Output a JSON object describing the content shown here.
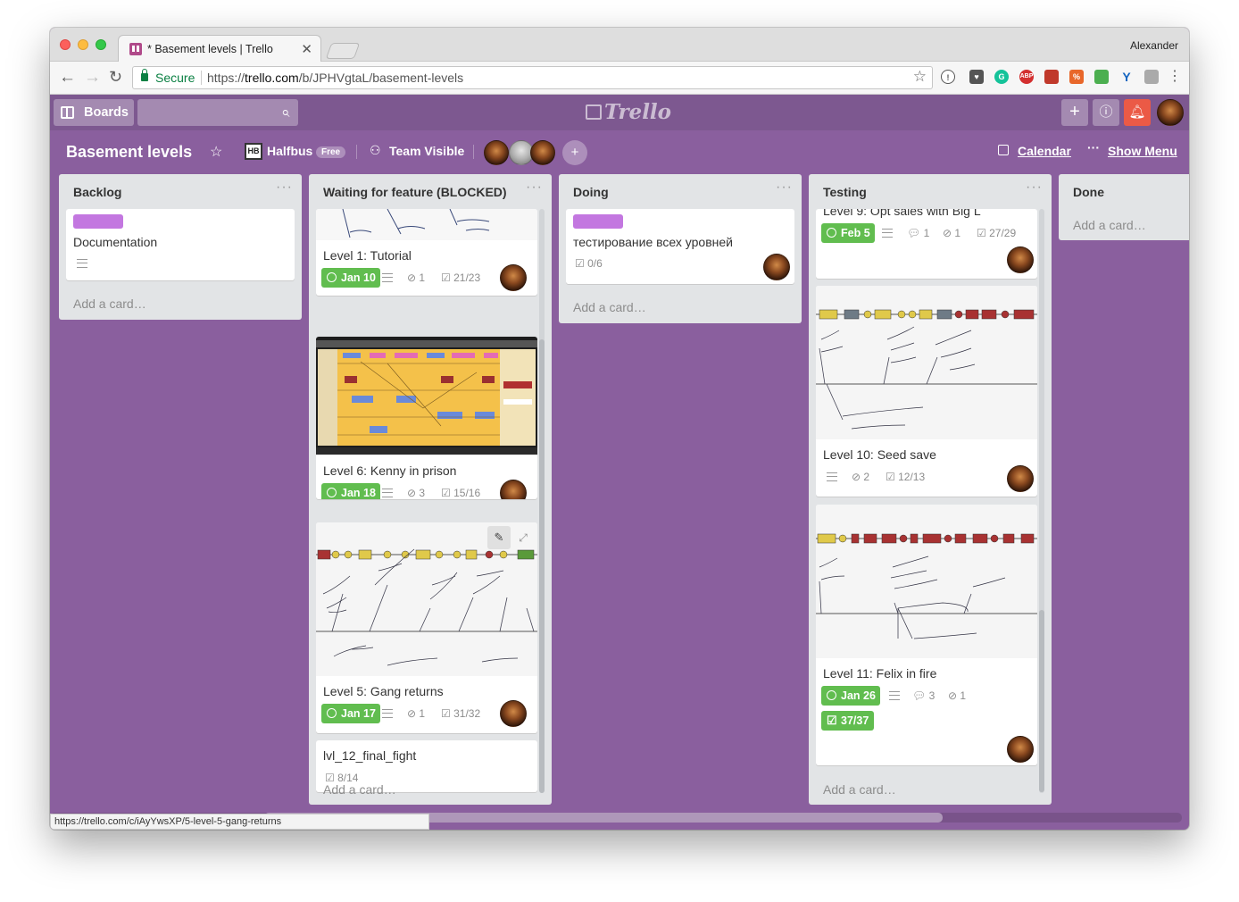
{
  "browser": {
    "tab_title": "* Basement levels | Trello",
    "profile_name": "Alexander",
    "secure_label": "Secure",
    "url_scheme": "https://",
    "url_host": "trello.com",
    "url_path": "/b/JPHVgtaL/basement-levels"
  },
  "header": {
    "boards_label": "Boards",
    "logo_text": "Trello"
  },
  "board": {
    "title": "Basement levels",
    "team_name": "Halfbus",
    "team_badge": "Free",
    "visibility": "Team Visible",
    "calendar_label": "Calendar",
    "show_menu_label": "Show Menu"
  },
  "lists": {
    "backlog": {
      "title": "Backlog",
      "add_card": "Add a card…",
      "cards": [
        {
          "title": "Documentation",
          "label_color": "#c377e0"
        }
      ]
    },
    "waiting": {
      "title": "Waiting for feature (BLOCKED)",
      "add_card": "Add a card…",
      "cards": [
        {
          "title": "Level 1: Tutorial",
          "due": "Jan 10",
          "attachments": "1",
          "checklist": "21/23"
        },
        {
          "title": "Level 6: Kenny in prison",
          "due": "Jan 18",
          "attachments": "3",
          "checklist": "15/16"
        },
        {
          "title": "Level 5: Gang returns",
          "due": "Jan 17",
          "attachments": "1",
          "checklist": "31/32"
        },
        {
          "title": "lvl_12_final_fight",
          "checklist": "8/14"
        }
      ]
    },
    "doing": {
      "title": "Doing",
      "add_card": "Add a card…",
      "cards": [
        {
          "title": "тестирование всех уровней",
          "checklist": "0/6",
          "label_color": "#c377e0"
        }
      ]
    },
    "testing": {
      "title": "Testing",
      "add_card": "Add a card…",
      "cards": [
        {
          "title": "Level 9: Opt sales with Big L",
          "due": "Feb 5",
          "comments": "1",
          "attachments": "1",
          "checklist": "27/29"
        },
        {
          "title": "Level 10: Seed save",
          "attachments": "2",
          "checklist": "12/13"
        },
        {
          "title": "Level 11: Felix in fire",
          "due": "Jan 26",
          "comments": "3",
          "attachments": "1",
          "checklist": "37/37"
        }
      ]
    },
    "done": {
      "title": "Done",
      "add_card": "Add a card…"
    }
  },
  "status_bar_url": "https://trello.com/c/iAyYwsXP/5-level-5-gang-returns",
  "colors": {
    "board_bg": "#8a5f9e",
    "header_bg": "#7d5890",
    "due_green": "#61bd4f",
    "label_purple": "#c377e0",
    "notification_red": "#eb5a46"
  }
}
